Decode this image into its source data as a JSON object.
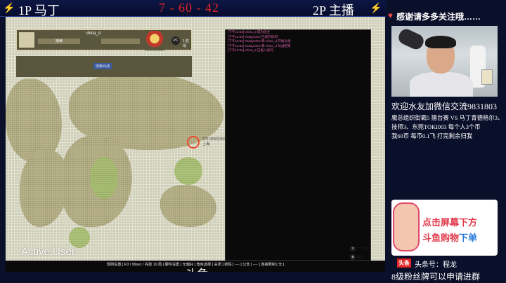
{
  "scoreboard": {
    "player1": "1P 马丁",
    "score": "7 - 60 - 42",
    "player2": "2P 主播"
  },
  "game": {
    "profile": {
      "name": "china_d",
      "slot1": "接续",
      "slot2": "",
      "rank": "1 胜场",
      "pc_badge": "PC"
    },
    "lobby_button": "搜索对战",
    "location_label": [
      "2021年8月25日",
      "上海"
    ],
    "chat_lines": [
      "[下午10:34] china_d 成为房主",
      "[下午10:34] TodayCEO 已离开房间",
      "[下午10:34] TodayCEO 和 china_d 开始对战",
      "[下午10:34] TodayCEO 和 china_d 对战结束",
      "[下午10:34] china_d 已进入房间"
    ],
    "active_user": "Active User",
    "hints": [
      {
        "key": "Y",
        "label": "个人资料"
      },
      {
        "key": "B",
        "label": "返回"
      }
    ],
    "settings_bar": "规则设置 [ R3 / 99sec / 先取 10 局 ]   硬件设置 [ 无偏好 ]   角色选择 [ 关闭 ]   密码 [ ---- ]   公告 [ ---- ]   连接限制 [ 无 ]",
    "overlay_text": "斗鱼"
  },
  "sidebar": {
    "thanks": "感谢请多多关注哦……",
    "welcome": "欢迎水友加微信交流9831803",
    "info_lines": [
      "魔总组织街霸5 擂台赛 VS 马丁青德格尔3、",
      "技师3、东莞TOKI003  每个人3个币",
      "我60币  每币0.1飞 打完剩余归我"
    ],
    "ad_line1": "点击屏幕下方",
    "ad_line2a": "斗鱼购物",
    "ad_line2b": "下单",
    "toutiao_badge": "头条",
    "toutiao_text": "头条号：程龙",
    "fans": "8级粉丝牌可以申请进群"
  },
  "colors": {
    "score_red": "#e02424",
    "chat_pink": "#e060b0",
    "ad_red": "#e0384a",
    "ad_blue": "#2a78d8",
    "panel_bg": "#0a0f2a"
  }
}
